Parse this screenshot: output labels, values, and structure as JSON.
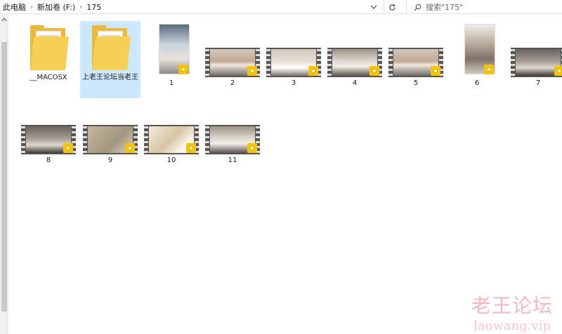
{
  "breadcrumb": {
    "items": [
      "此电脑",
      "新加卷 (F:)",
      "175"
    ]
  },
  "search": {
    "placeholder": "搜索\"175\""
  },
  "icons": {
    "separator": "chevron-right-icon",
    "dropdown": "chevron-down-icon",
    "refresh": "refresh-icon",
    "search": "search-icon",
    "badge": "player-badge-icon"
  },
  "colors": {
    "selected": "#cce8ff",
    "folder": "#e8b93a",
    "badge": "#f5c400",
    "watermark": "#f3b9bf"
  },
  "files": [
    {
      "name": "__MACOSX",
      "type": "folder"
    },
    {
      "name": "上老王论坛当老王",
      "type": "folder",
      "selected": true
    },
    {
      "name": "1",
      "type": "video-portrait"
    },
    {
      "name": "2",
      "type": "video"
    },
    {
      "name": "3",
      "type": "video"
    },
    {
      "name": "4",
      "type": "video"
    },
    {
      "name": "5",
      "type": "video"
    },
    {
      "name": "6",
      "type": "video-portrait"
    },
    {
      "name": "7",
      "type": "video"
    },
    {
      "name": "8",
      "type": "video"
    },
    {
      "name": "9",
      "type": "video"
    },
    {
      "name": "10",
      "type": "video"
    },
    {
      "name": "11",
      "type": "video"
    }
  ],
  "badge_text": "Player",
  "watermark": {
    "cn": "老王论坛",
    "en": "laowang.vip"
  }
}
